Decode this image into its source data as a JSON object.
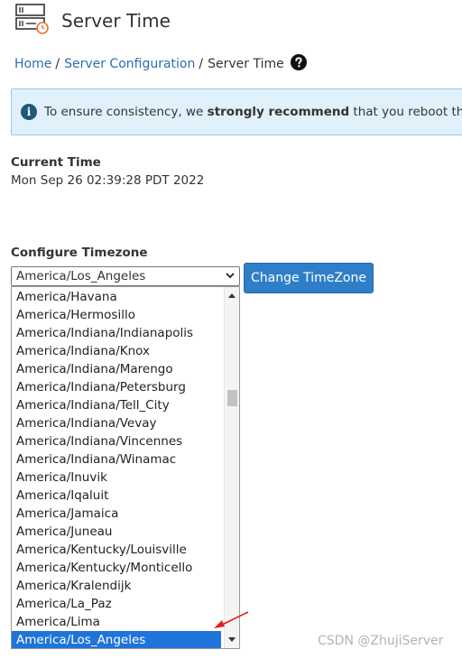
{
  "page": {
    "title": "Server Time",
    "icon": "server-clock-icon"
  },
  "breadcrumb": {
    "home": "Home",
    "sep1": "/",
    "section": "Server Configuration",
    "sep2": "/",
    "current": "Server Time",
    "help_icon": "question-circle-icon"
  },
  "alert": {
    "icon": "info-icon",
    "text_before": "To ensure consistency, we ",
    "text_bold": "strongly recommend",
    "text_after": " that you reboot the se"
  },
  "current_time": {
    "label": "Current Time",
    "value": "Mon Sep 26 02:39:28 PDT 2022"
  },
  "timezone": {
    "label": "Configure Timezone",
    "selected": "America/Los_Angeles",
    "button": "Change TimeZone",
    "options": [
      "America/Havana",
      "America/Hermosillo",
      "America/Indiana/Indianapolis",
      "America/Indiana/Knox",
      "America/Indiana/Marengo",
      "America/Indiana/Petersburg",
      "America/Indiana/Tell_City",
      "America/Indiana/Vevay",
      "America/Indiana/Vincennes",
      "America/Indiana/Winamac",
      "America/Inuvik",
      "America/Iqaluit",
      "America/Jamaica",
      "America/Juneau",
      "America/Kentucky/Louisville",
      "America/Kentucky/Monticello",
      "America/Kralendijk",
      "America/La_Paz",
      "America/Lima",
      "America/Los_Angeles"
    ],
    "selected_index": 19
  },
  "annotation": {
    "arrow_color": "#e02020"
  },
  "watermark": "CSDN @ZhujiServer",
  "colors": {
    "link": "#2a6fb0",
    "button_bg": "#2e7fc8",
    "alert_bg": "#e1f1fb",
    "alert_border": "#99cbe8",
    "selected_bg": "#1e74d9"
  }
}
